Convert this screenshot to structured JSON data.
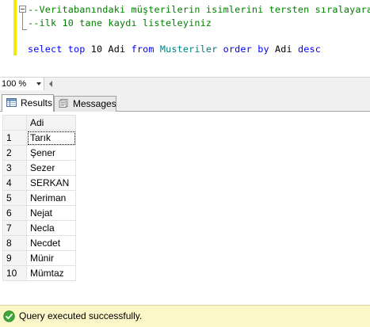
{
  "editor": {
    "lines": [
      {
        "segments": [
          {
            "cls": "cmt",
            "text": "--Veritabanındaki müşterilerin isimlerini tersten sıralayarak"
          }
        ]
      },
      {
        "segments": [
          {
            "cls": "cmt",
            "text": "--ilk 10 tane kaydı listeleyiniz"
          }
        ]
      },
      {
        "segments": [
          {
            "cls": "kw",
            "text": "select"
          },
          {
            "cls": "plain",
            "text": " "
          },
          {
            "cls": "kw",
            "text": "top"
          },
          {
            "cls": "plain",
            "text": " 10 Adi "
          },
          {
            "cls": "kw",
            "text": "from"
          },
          {
            "cls": "plain",
            "text": " "
          },
          {
            "cls": "tbl",
            "text": "Musteriler"
          },
          {
            "cls": "plain",
            "text": " "
          },
          {
            "cls": "kw",
            "text": "order"
          },
          {
            "cls": "plain",
            "text": " "
          },
          {
            "cls": "kw",
            "text": "by"
          },
          {
            "cls": "plain",
            "text": " Adi "
          },
          {
            "cls": "kw",
            "text": "desc"
          }
        ]
      }
    ]
  },
  "zoom": {
    "value": "100 %"
  },
  "tabs": {
    "results_label": "Results",
    "messages_label": "Messages",
    "results_icon": "grid-icon",
    "messages_icon": "messages-icon"
  },
  "grid": {
    "column_header": "Adi",
    "rows": [
      {
        "num": "1",
        "value": "Tarık"
      },
      {
        "num": "2",
        "value": "Şener"
      },
      {
        "num": "3",
        "value": "Sezer"
      },
      {
        "num": "4",
        "value": "SERKAN"
      },
      {
        "num": "5",
        "value": "Neriman"
      },
      {
        "num": "6",
        "value": "Nejat"
      },
      {
        "num": "7",
        "value": "Necla"
      },
      {
        "num": "8",
        "value": "Necdet"
      },
      {
        "num": "9",
        "value": "Münir"
      },
      {
        "num": "10",
        "value": "Mümtaz"
      }
    ]
  },
  "status": {
    "text": "Query executed successfully.",
    "icon": "success-check-icon",
    "background_color": "#fbf7c8"
  }
}
